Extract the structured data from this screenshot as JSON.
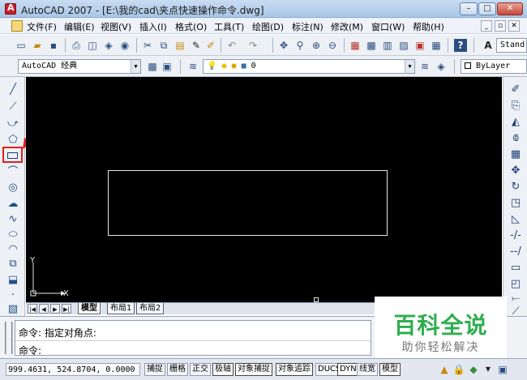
{
  "window": {
    "title": "AutoCAD 2007 - [E:\\我的cad\\夹点快速操作命令.dwg]",
    "minimize_glyph": "–",
    "maximize_glyph": "□",
    "close_glyph": "✕"
  },
  "menubar": {
    "items": [
      "文件(F)",
      "编辑(E)",
      "视图(V)",
      "插入(I)",
      "格式(O)",
      "工具(T)",
      "绘图(D)",
      "标注(N)",
      "修改(M)",
      "窗口(W)",
      "帮助(H)"
    ],
    "mdi_controls": [
      "_",
      "▫",
      "✕"
    ]
  },
  "toolbar1": {
    "text_style_combo": "Stand"
  },
  "toolbar2": {
    "workspace_combo": "AutoCAD 经典",
    "layer_combo": "0",
    "color_combo": "ByLayer"
  },
  "left_toolbar": {
    "icons": [
      "line-icon",
      "construction-line-icon",
      "polyline-icon",
      "polygon-icon",
      "rectangle-icon",
      "arc-icon",
      "circle-icon",
      "revision-cloud-icon",
      "spline-icon",
      "ellipse-icon",
      "ellipse-arc-icon",
      "insert-block-icon",
      "make-block-icon",
      "point-icon",
      "hatch-icon"
    ]
  },
  "right_toolbar": {
    "icons": [
      "erase-icon",
      "copy-icon",
      "mirror-icon",
      "offset-icon",
      "array-icon",
      "move-icon",
      "rotate-icon",
      "scale-icon",
      "stretch-icon",
      "trim-icon",
      "extend-icon",
      "break-icon",
      "chamfer-icon",
      "fillet-icon",
      "explode-icon"
    ]
  },
  "canvas": {
    "ucs_x_label": "X",
    "ucs_y_label": "Y"
  },
  "layout_tabs": {
    "nav": [
      "|◀",
      "◀",
      "▶",
      "▶|"
    ],
    "tabs": [
      "模型",
      "布局1",
      "布局2"
    ],
    "active": "模型"
  },
  "command": {
    "line1": "命令: 指定对角点:",
    "line2": "命令:"
  },
  "watermark": {
    "title": "百科全说",
    "subtitle": "助你轻松解决"
  },
  "statusbar": {
    "coordinates": "999.4631,  524.8704, 0.0000",
    "toggles": [
      "捕捉",
      "栅格",
      "正交",
      "极轴",
      "对象捕捉",
      "对象追踪",
      "DUCS",
      "DYN",
      "线宽",
      "模型"
    ]
  }
}
